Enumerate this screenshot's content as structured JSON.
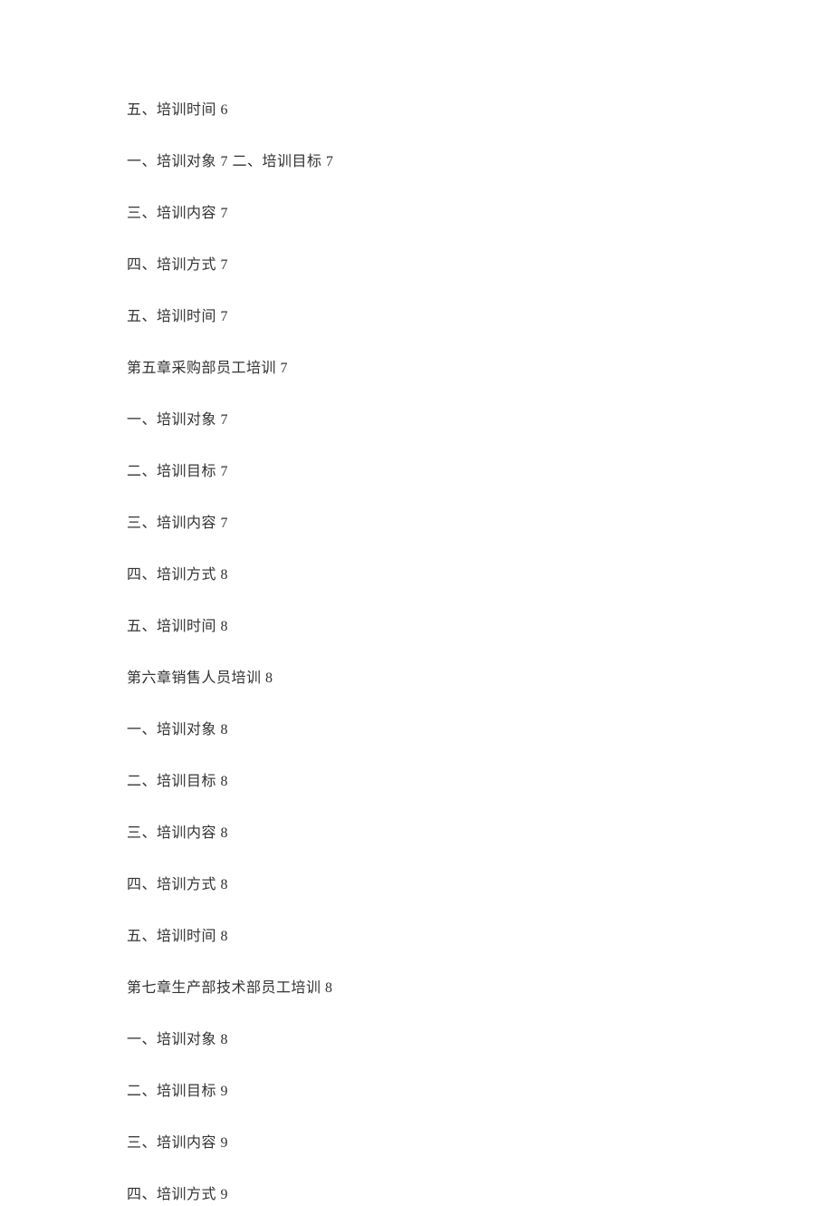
{
  "toc": [
    "五、培训时间 6",
    "一、培训对象 7 二、培训目标 7",
    "三、培训内容 7",
    "四、培训方式 7",
    "五、培训时间 7",
    "第五章采购部员工培训 7",
    "一、培训对象 7",
    "二、培训目标 7",
    "三、培训内容 7",
    "四、培训方式 8",
    "五、培训时间 8",
    "第六章销售人员培训 8",
    "一、培训对象 8",
    "二、培训目标 8",
    "三、培训内容 8",
    "四、培训方式 8",
    "五、培训时间 8",
    "第七章生产部技术部员工培训 8",
    "一、培训对象 8",
    "二、培训目标 9",
    "三、培训内容 9",
    "四、培训方式 9"
  ]
}
